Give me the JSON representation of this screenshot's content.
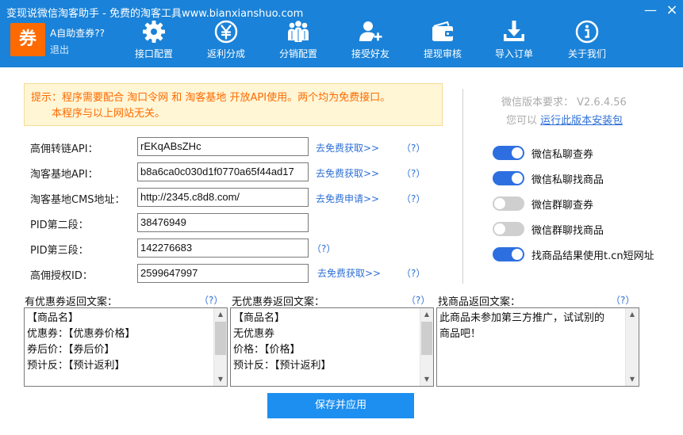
{
  "window": {
    "title": "变现说微信淘客助手 - 免费的淘客工具www.bianxianshuo.com",
    "minimize": "—",
    "close": "×"
  },
  "account": {
    "logo": "券",
    "name": "A自助查券??",
    "logout": "退出"
  },
  "nav": [
    {
      "label": "接口配置",
      "icon": "gear-icon"
    },
    {
      "label": "返利分成",
      "icon": "yen-icon"
    },
    {
      "label": "分销配置",
      "icon": "group-icon"
    },
    {
      "label": "接受好友",
      "icon": "add-friend-icon"
    },
    {
      "label": "提现审核",
      "icon": "wallet-icon"
    },
    {
      "label": "导入订单",
      "icon": "download-icon"
    },
    {
      "label": "关于我们",
      "icon": "info-icon"
    }
  ],
  "notice": {
    "line1": "提示：程序需要配合 淘口令网 和 淘客基地 开放API使用。两个均为免费接口。",
    "line2": "本程序与以上网站无关。"
  },
  "fields": [
    {
      "label": "高佣转链API：",
      "value": "rEKqABsZHc",
      "link": "去免费获取>>",
      "help": "（?）"
    },
    {
      "label": "淘客基地API：",
      "value": "b8a6ca0c030d1f0770a65f44ad17",
      "link": "去免费获取>>",
      "help": "（?）"
    },
    {
      "label": "淘客基地CMS地址：",
      "value": "http://2345.c8d8.com/",
      "link": "去免费申请>>",
      "help": "（?）"
    },
    {
      "label": "PID第二段：",
      "value": "38476949"
    },
    {
      "label": "PID第三段：",
      "value": "142276683",
      "help": "（?）"
    },
    {
      "label": "高佣授权ID：",
      "value": "2599647997",
      "link": "去免费获取>>",
      "help": "（?）"
    }
  ],
  "version": {
    "requirement": "微信版本要求： V2.6.4.56",
    "tip_prefix": "您可以",
    "tip_link": "运行此版本安装包"
  },
  "toggles": [
    {
      "label": "微信私聊查券",
      "state": "on"
    },
    {
      "label": "微信私聊找商品",
      "state": "on"
    },
    {
      "label": "微信群聊查券",
      "state": "off"
    },
    {
      "label": "微信群聊找商品",
      "state": "off"
    },
    {
      "label": "找商品结果使用t.cn短网址",
      "state": "on"
    }
  ],
  "templates": [
    {
      "label": "有优惠券返回文案：",
      "help": "（?）",
      "lines": [
        "【商品名】",
        "优惠券：【优惠券价格】",
        "券后价：【券后价】",
        "预计反：【预计返利】"
      ]
    },
    {
      "label": "无优惠券返回文案：",
      "help": "（?）",
      "lines": [
        "【商品名】",
        "无优惠券",
        "价格：【价格】",
        "预计反：【预计返利】"
      ]
    },
    {
      "label": "找商品返回文案：",
      "help": "（?）",
      "lines": [
        "此商品未参加第三方推广，试试别的",
        "商品吧！"
      ]
    }
  ],
  "save_label": "保存并应用",
  "colors": {
    "header": "#1a82d8",
    "logo": "#ff6a00",
    "notice_text": "#ff6a00",
    "notice_bg": "#fff6d6",
    "link": "#2d6fd6",
    "toggle_on": "#2d6fe0",
    "toggle_off": "#cfcfcf",
    "save_button": "#1d8ff0"
  }
}
